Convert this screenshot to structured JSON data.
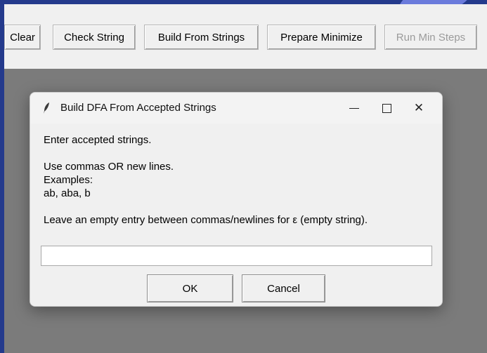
{
  "toolbar": {
    "buttons": [
      {
        "label": "Clear",
        "enabled": true
      },
      {
        "label": "Check String",
        "enabled": true
      },
      {
        "label": "Build From Strings",
        "enabled": true
      },
      {
        "label": "Prepare Minimize",
        "enabled": true
      },
      {
        "label": "Run Min Steps",
        "enabled": false
      }
    ]
  },
  "dialog": {
    "title": "Build DFA From Accepted Strings",
    "icon": "feather-icon",
    "message": "Enter accepted strings.\n\nUse commas OR new lines.\nExamples:\nab, aba, b\n\nLeave an empty entry between commas/newlines for ε (empty string).",
    "input_value": "",
    "ok_label": "OK",
    "cancel_label": "Cancel",
    "window_controls": {
      "minimize": "minimize-icon",
      "maximize": "maximize-icon",
      "close": "close-icon",
      "close_glyph": "✕"
    }
  },
  "colors": {
    "desktop": "#243a8c",
    "app_background": "#7b7b7b",
    "toolbar": "#f0f0f0",
    "disabled_text": "#9b9b9b"
  }
}
